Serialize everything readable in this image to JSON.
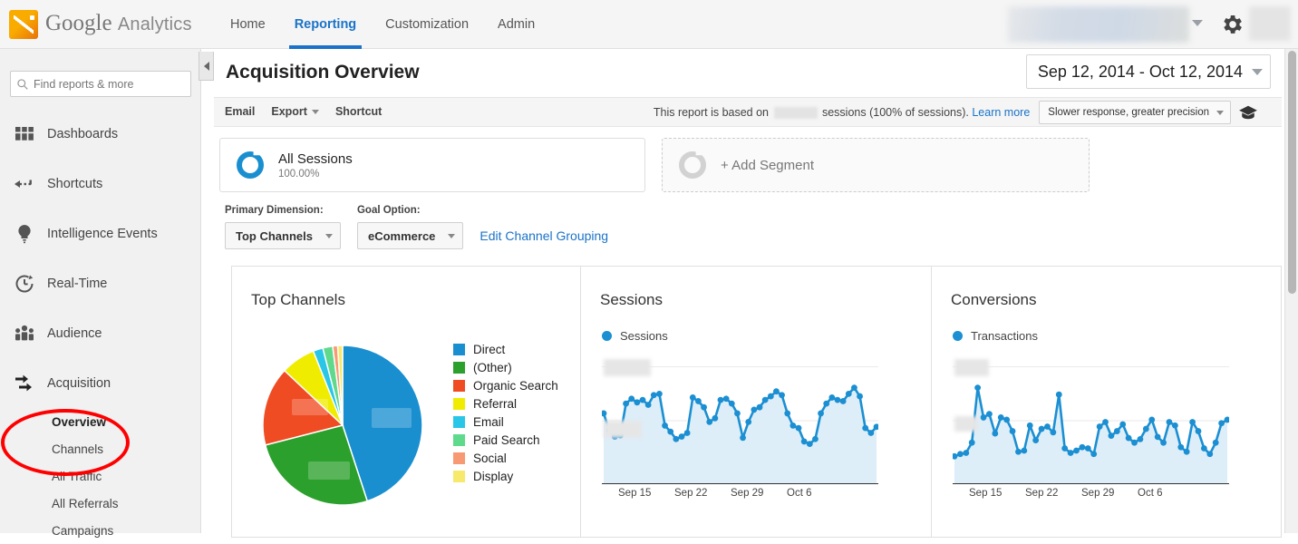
{
  "app": {
    "brand_primary": "Google",
    "brand_secondary": "Analytics",
    "logo_icon": "google-analytics-logo-icon",
    "accent_color": "#1a73c8",
    "chart_blue": "#1b8fd2"
  },
  "topnav": {
    "items": [
      {
        "label": "Home",
        "active": false
      },
      {
        "label": "Reporting",
        "active": true
      },
      {
        "label": "Customization",
        "active": false
      },
      {
        "label": "Admin",
        "active": false
      }
    ],
    "account_selector": "",
    "gear_icon": "gear-icon",
    "avatar": "avatar"
  },
  "sidebar": {
    "search_placeholder": "Find reports & more",
    "search_icon": "search-icon",
    "items": [
      {
        "label": "Dashboards",
        "icon": "grid-icon"
      },
      {
        "label": "Shortcuts",
        "icon": "arrow-left-dashed-icon"
      },
      {
        "label": "Intelligence Events",
        "icon": "lightbulb-icon"
      },
      {
        "label": "Real-Time",
        "icon": "clock-icon"
      },
      {
        "label": "Audience",
        "icon": "people-icon"
      },
      {
        "label": "Acquisition",
        "icon": "arrows-right-icon"
      }
    ],
    "subitems": [
      {
        "label": "Overview",
        "selected": true
      },
      {
        "label": "Channels",
        "selected": false
      },
      {
        "label": "All Traffic",
        "selected": false
      },
      {
        "label": "All Referrals",
        "selected": false
      },
      {
        "label": "Campaigns",
        "selected": false
      }
    ],
    "collapse_icon": "collapse-left-icon"
  },
  "annotation": {
    "shape": "ellipse",
    "color": "#ff0000"
  },
  "header": {
    "title": "Acquisition Overview",
    "date_range": "Sep 12, 2014 - Oct 12, 2014",
    "date_caret_icon": "chevron-down-icon"
  },
  "actions": {
    "email": "Email",
    "export": "Export",
    "export_caret_icon": "chevron-down-icon",
    "shortcut": "Shortcut",
    "sampling_prefix": "This report is based on",
    "sampling_redacted": "",
    "sampling_suffix": "sessions (100% of sessions).",
    "learn_more": "Learn more",
    "precision_option": "Slower response, greater precision",
    "precision_caret_icon": "chevron-down-icon",
    "help_icon": "graduation-cap-icon"
  },
  "segments": {
    "all_sessions_name": "All Sessions",
    "all_sessions_pct": "100.00%",
    "all_sessions_icon": "segment-ring-icon",
    "add_segment_label": "+ Add Segment",
    "add_segment_icon": "segment-ring-empty-icon"
  },
  "controls": {
    "primary_dimension_label": "Primary Dimension:",
    "primary_dimension_value": "Top Channels",
    "goal_option_label": "Goal Option:",
    "goal_option_value": "eCommerce",
    "edit_channel_grouping": "Edit Channel Grouping",
    "select_caret_icon": "chevron-down-icon"
  },
  "chart_data": [
    {
      "type": "pie",
      "title": "Top Channels",
      "panel": "top-channels",
      "labels": [
        "Direct",
        "(Other)",
        "Organic Search",
        "Referral",
        "Email",
        "Paid Search",
        "Social",
        "Display"
      ],
      "values": [
        45,
        26,
        16,
        7,
        2,
        2,
        1,
        1
      ],
      "colors": [
        "#1a8fd0",
        "#2ca02c",
        "#f04c23",
        "#f0ec00",
        "#29c6e8",
        "#5fd98b",
        "#f79a73",
        "#f7e96b"
      ],
      "legend_position": "right",
      "labels_redacted": true
    },
    {
      "type": "area",
      "title": "Sessions",
      "panel": "sessions",
      "series": [
        {
          "name": "Sessions",
          "values": [
            52,
            38,
            33,
            34,
            60,
            64,
            61,
            63,
            59,
            67,
            68,
            42,
            37,
            31,
            33,
            36,
            65,
            62,
            57,
            45,
            48,
            63,
            64,
            60,
            52,
            32,
            45,
            55,
            57,
            63,
            66,
            70,
            67,
            52,
            42,
            40,
            29,
            27,
            31,
            52,
            60,
            65,
            63,
            62,
            68,
            73,
            66,
            40,
            36,
            41
          ]
        }
      ],
      "color": "#1b8fd2",
      "xlabel": "",
      "ylabel": "",
      "x_ticks": [
        "Sep 15",
        "Sep 22",
        "Sep 29",
        "Oct 6"
      ],
      "y_ticks_redacted": true,
      "grid": true,
      "fill": "#ddeef9"
    },
    {
      "type": "area",
      "title": "Conversions",
      "panel": "conversions",
      "series": [
        {
          "name": "Transactions",
          "values": [
            18,
            20,
            21,
            30,
            78,
            52,
            55,
            38,
            52,
            50,
            40,
            22,
            23,
            45,
            32,
            42,
            44,
            39,
            72,
            25,
            21,
            23,
            26,
            25,
            20,
            44,
            48,
            36,
            40,
            46,
            34,
            30,
            33,
            42,
            50,
            35,
            30,
            48,
            45,
            26,
            22,
            48,
            40,
            25,
            20,
            30,
            47,
            50
          ]
        }
      ],
      "color": "#1b8fd2",
      "xlabel": "",
      "ylabel": "",
      "x_ticks": [
        "Sep 15",
        "Sep 22",
        "Sep 29",
        "Oct 6"
      ],
      "y_ticks_redacted": true,
      "grid": true,
      "fill": "#ddeef9"
    }
  ]
}
